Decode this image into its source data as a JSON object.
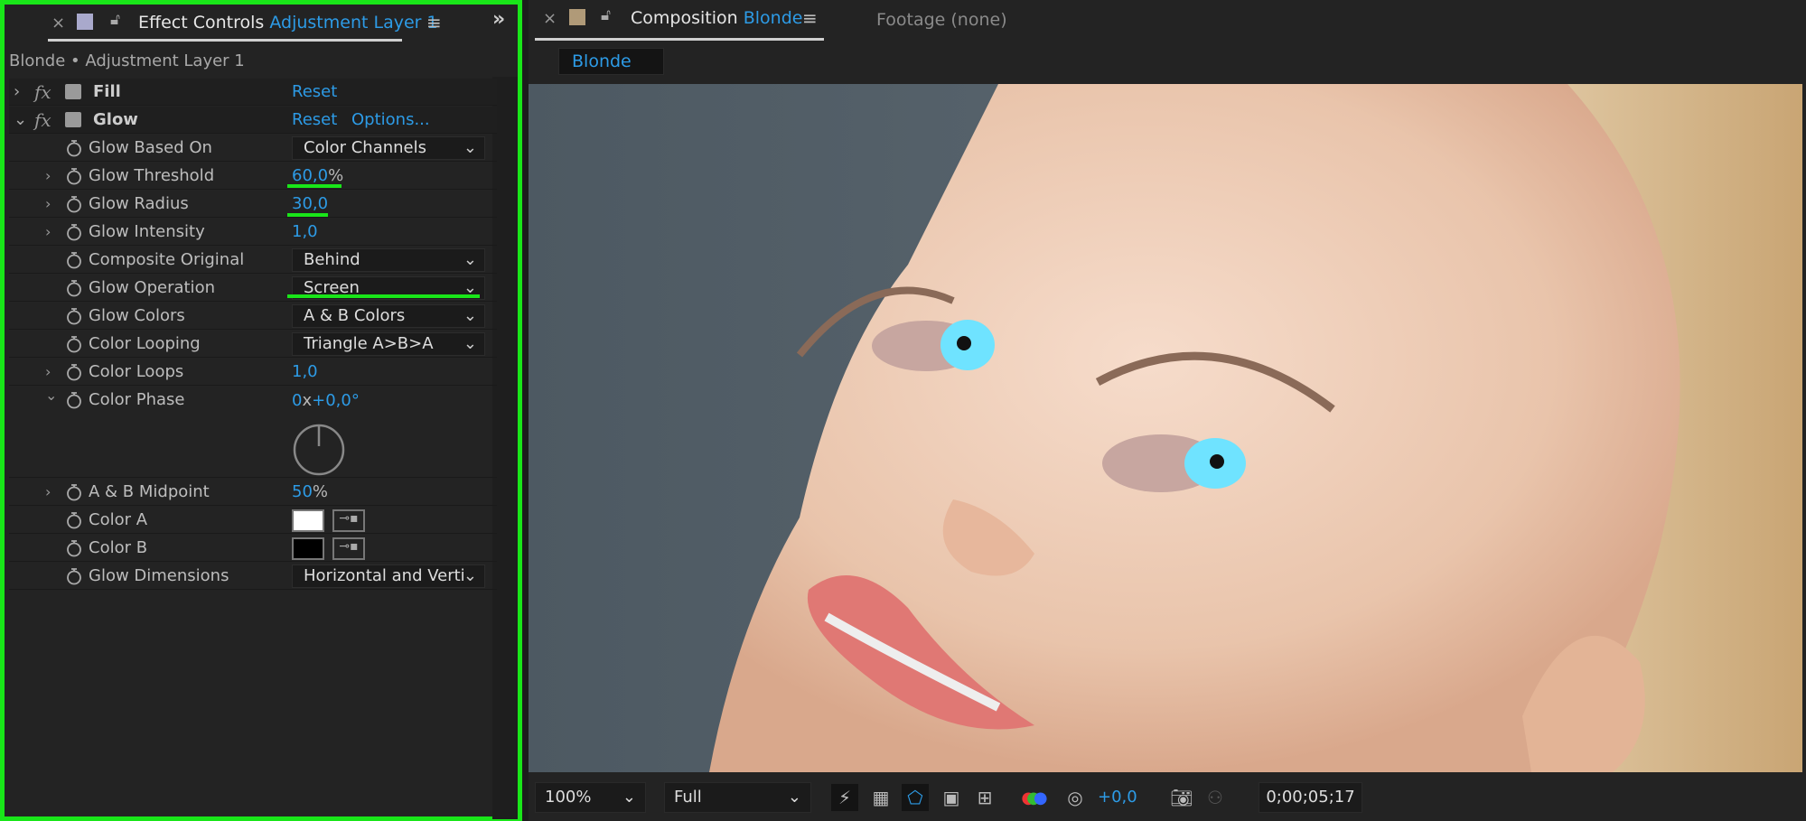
{
  "effect_controls": {
    "tab_prefix": "Effect Controls",
    "tab_layer": "Adjustment Layer 1",
    "breadcrumb": "Blonde • Adjustment Layer 1",
    "effects": [
      {
        "name": "Fill",
        "reset": "Reset"
      },
      {
        "name": "Glow",
        "reset": "Reset",
        "options": "Options..."
      }
    ],
    "properties": [
      {
        "label": "Glow Based On",
        "type": "dropdown",
        "value": "Color Channels"
      },
      {
        "label": "Glow Threshold",
        "type": "number",
        "value": "60,0",
        "unit": "%"
      },
      {
        "label": "Glow Radius",
        "type": "number",
        "value": "30,0"
      },
      {
        "label": "Glow Intensity",
        "type": "number",
        "value": "1,0"
      },
      {
        "label": "Composite Original",
        "type": "dropdown",
        "value": "Behind"
      },
      {
        "label": "Glow Operation",
        "type": "dropdown",
        "value": "Screen"
      },
      {
        "label": "Glow Colors",
        "type": "dropdown",
        "value": "A & B Colors"
      },
      {
        "label": "Color Looping",
        "type": "dropdown",
        "value": "Triangle A>B>A"
      },
      {
        "label": "Color Loops",
        "type": "number",
        "value": "1,0"
      },
      {
        "label": "Color Phase",
        "type": "angle",
        "rev": "0",
        "x": "x",
        "deg": "+0,0°"
      },
      {
        "label": "A & B Midpoint",
        "type": "number",
        "value": "50",
        "unit": "%"
      },
      {
        "label": "Color A",
        "type": "color",
        "color": "#ffffff"
      },
      {
        "label": "Color B",
        "type": "color",
        "color": "#000000"
      },
      {
        "label": "Glow Dimensions",
        "type": "dropdown",
        "value": "Horizontal and Verti"
      }
    ]
  },
  "composition": {
    "tab_prefix": "Composition",
    "tab_name": "Blonde",
    "footage_tab": "Footage (none)",
    "breadcrumb_button": "Blonde"
  },
  "toolbar": {
    "zoom": "100%",
    "resolution": "Full",
    "exposure": "+0,0",
    "timecode": "0;00;05;17"
  },
  "colors": {
    "accent": "#2d9be6",
    "highlight": "#19e619",
    "eye_glow": "#6fe3ff"
  }
}
